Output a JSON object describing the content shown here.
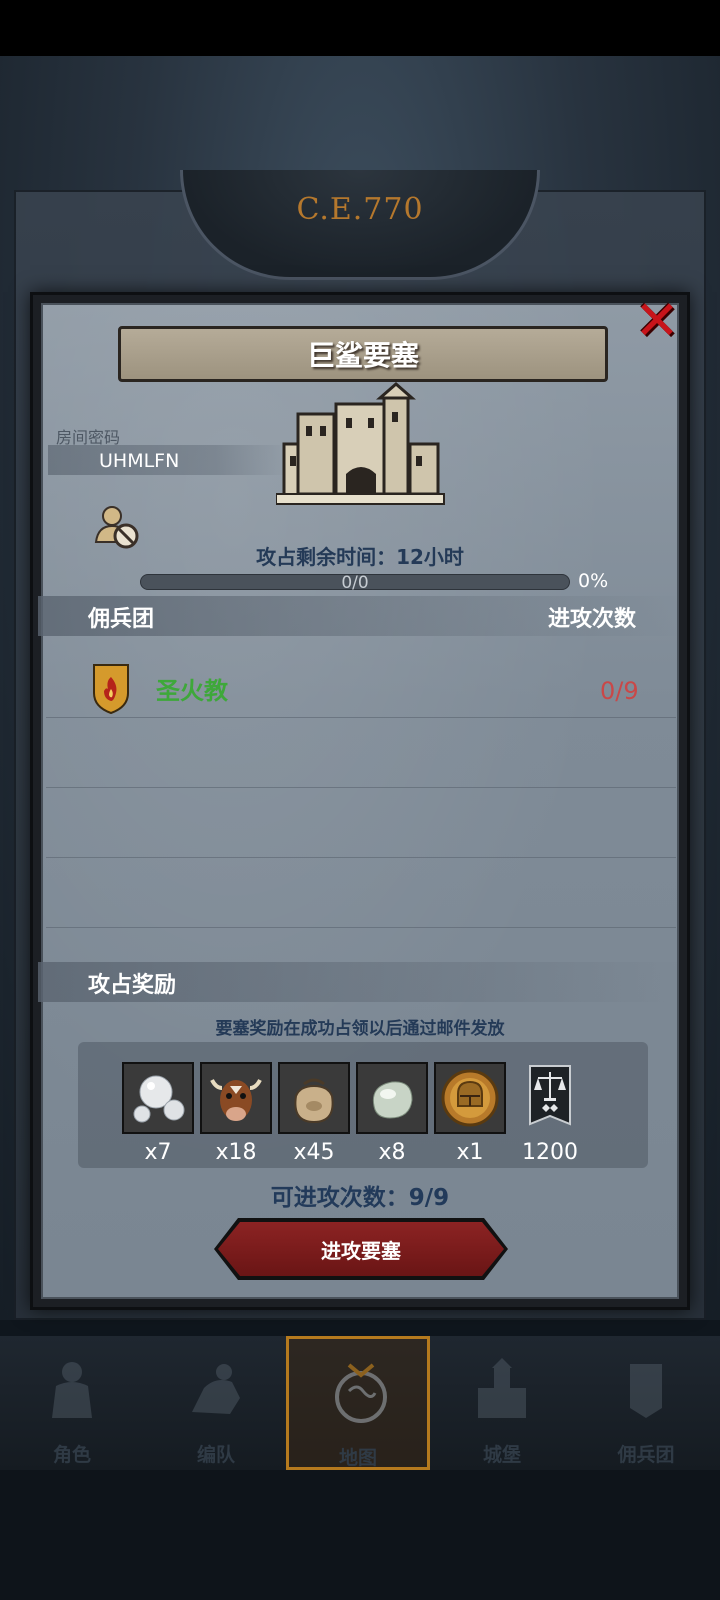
{
  "background": {
    "era": "C.E.770"
  },
  "dialog": {
    "title": "巨鲨要塞",
    "close_icon": "close-x-icon",
    "room_label": "房间密码",
    "room_code": "UHMLFN",
    "capture_time": "攻占剩余时间：12小时",
    "progress": {
      "text": "0/0",
      "percent_label": "0%",
      "fraction": 0
    },
    "mercenary_header": "佣兵团",
    "attacks_header": "进攻次数",
    "mercenaries": [
      {
        "name": "圣火教",
        "attacks": "0/9",
        "icon": "fire-shield-icon"
      }
    ],
    "rewards_header": "攻占奖励",
    "rewards_note": "要塞奖励在成功占领以后通过邮件发放",
    "rewards": [
      {
        "icon": "pearls-icon",
        "qty": "x7"
      },
      {
        "icon": "cattle-icon",
        "qty": "x18"
      },
      {
        "icon": "grain-sack-icon",
        "qty": "x45"
      },
      {
        "icon": "moonstone-icon",
        "qty": "x8"
      },
      {
        "icon": "knight-helmet-coin-icon",
        "qty": "x1"
      },
      {
        "icon": "justice-banner-icon",
        "qty": "1200"
      }
    ],
    "attacks_available": "可进攻次数：9/9",
    "attack_button": "进攻要塞"
  },
  "bottom_nav": {
    "items": [
      {
        "label": "角色",
        "icon": "knight-icon"
      },
      {
        "label": "编队",
        "icon": "cavalry-icon"
      },
      {
        "label": "地图",
        "icon": "map-globe-icon",
        "active": true
      },
      {
        "label": "城堡",
        "icon": "castle-icon"
      },
      {
        "label": "佣兵团",
        "icon": "mercenary-banner-icon"
      }
    ]
  },
  "colors": {
    "accent_red": "#c8141a",
    "attack_button": "#8c2323",
    "mercenary_green": "#3ea83a",
    "count_red": "#c94848",
    "nav_active": "#b57a1e"
  }
}
